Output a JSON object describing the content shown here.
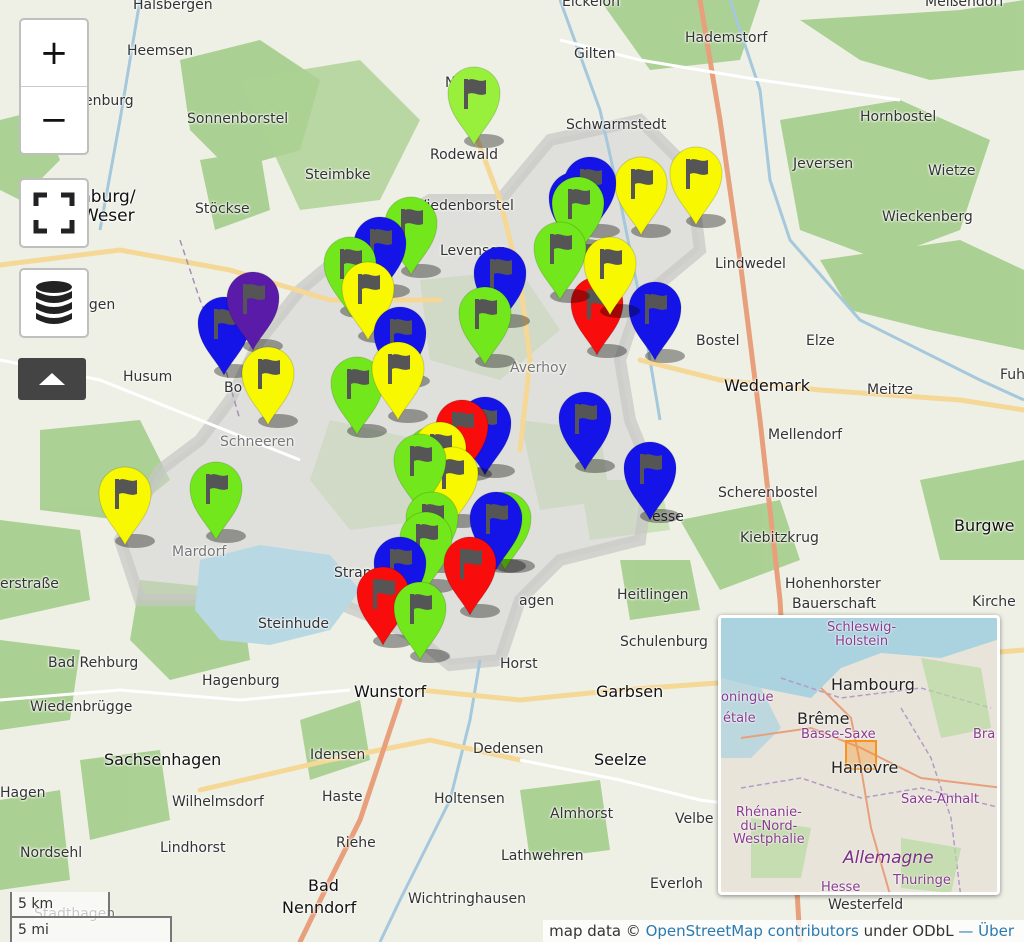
{
  "map": {
    "places": [
      {
        "name": "Halsbergen"
      },
      {
        "name": "Eickeloh"
      },
      {
        "name": "Meißendorf"
      },
      {
        "name": "Heemsen"
      },
      {
        "name": "Gilten"
      },
      {
        "name": "Hademstorf"
      },
      {
        "name": "enburg"
      },
      {
        "name": "Sonnenborstel"
      },
      {
        "name": "Nordel"
      },
      {
        "name": "Schwarmstedt"
      },
      {
        "name": "Hornbostel"
      },
      {
        "name": "Rodewald"
      },
      {
        "name": "Jeversen"
      },
      {
        "name": "Wietze"
      },
      {
        "name": "nburg/"
      },
      {
        "name": "Weser"
      },
      {
        "name": "Steimbke"
      },
      {
        "name": "Wiedenborstel"
      },
      {
        "name": "Stöckse"
      },
      {
        "name": "Wieckenberg"
      },
      {
        "name": "Levensen"
      },
      {
        "name": "Lindwedel"
      },
      {
        "name": "ngen"
      },
      {
        "name": "Bostel"
      },
      {
        "name": "Elze"
      },
      {
        "name": "Averhoy"
      },
      {
        "name": "Husum"
      },
      {
        "name": "Wedemark"
      },
      {
        "name": "Meitze"
      },
      {
        "name": "Fuh"
      },
      {
        "name": "Bo"
      },
      {
        "name": "Schneeren"
      },
      {
        "name": "Mellendorf"
      },
      {
        "name": "Scherenbostel"
      },
      {
        "name": "Burgwe"
      },
      {
        "name": "Mardorf"
      },
      {
        "name": "esse"
      },
      {
        "name": "Kiebitzkrug"
      },
      {
        "name": "erstraße"
      },
      {
        "name": "Strand"
      },
      {
        "name": "Hohenhorster"
      },
      {
        "name": "Bauerschaft"
      },
      {
        "name": "Kirche"
      },
      {
        "name": "Heitlingen"
      },
      {
        "name": "Steinhude"
      },
      {
        "name": "agen"
      },
      {
        "name": "Schulenburg"
      },
      {
        "name": "Bad Rehburg"
      },
      {
        "name": "Horst"
      },
      {
        "name": "Hagenburg"
      },
      {
        "name": "Wunstorf"
      },
      {
        "name": "Garbsen"
      },
      {
        "name": "Wiedenbrügge"
      },
      {
        "name": "Dedensen"
      },
      {
        "name": "Sachsenhagen"
      },
      {
        "name": "Idensen"
      },
      {
        "name": "Seelze"
      },
      {
        "name": "Hagen"
      },
      {
        "name": "Haste"
      },
      {
        "name": "Holtensen"
      },
      {
        "name": "Wilhelmsdorf"
      },
      {
        "name": "Almhorst"
      },
      {
        "name": "Velbe"
      },
      {
        "name": "Riehe"
      },
      {
        "name": "Nordsehl"
      },
      {
        "name": "Lindhorst"
      },
      {
        "name": "Lathwehren"
      },
      {
        "name": "Bad"
      },
      {
        "name": "Nenndorf"
      },
      {
        "name": "Everloh"
      },
      {
        "name": "Wichtringhausen"
      },
      {
        "name": "Westerfeld"
      },
      {
        "name": "Stadthagen"
      }
    ],
    "markers": [
      {
        "color": "#98f03c"
      },
      {
        "color": "#f8f800"
      },
      {
        "color": "#f8f800"
      },
      {
        "color": "#1414e8"
      },
      {
        "color": "#1414e8"
      },
      {
        "color": "#72e81c"
      },
      {
        "color": "#72e81c"
      },
      {
        "color": "#1414e8"
      },
      {
        "color": "#72e81c"
      },
      {
        "color": "#1414e8"
      },
      {
        "color": "#f8f800"
      },
      {
        "color": "#1414e8"
      },
      {
        "color": "#72e81c"
      },
      {
        "color": "#f80c0c"
      },
      {
        "color": "#1414e8"
      },
      {
        "color": "#5a1ca8"
      },
      {
        "color": "#1414e8"
      },
      {
        "color": "#f8f800"
      },
      {
        "color": "#72e81c"
      },
      {
        "color": "#f8f800"
      },
      {
        "color": "#1414e8"
      },
      {
        "color": "#f8f800"
      },
      {
        "color": "#72e81c"
      },
      {
        "color": "#72e81c"
      },
      {
        "color": "#1414e8"
      },
      {
        "color": "#f8f800"
      },
      {
        "color": "#72e81c"
      },
      {
        "color": "#f80c0c"
      },
      {
        "color": "#1414e8"
      },
      {
        "color": "#f8f800"
      },
      {
        "color": "#f8f800"
      },
      {
        "color": "#72e81c"
      },
      {
        "color": "#72e81c"
      },
      {
        "color": "#72e81c"
      },
      {
        "color": "#1414e8"
      },
      {
        "color": "#72e81c"
      },
      {
        "color": "#1414e8"
      },
      {
        "color": "#f80c0c"
      },
      {
        "color": "#f80c0c"
      },
      {
        "color": "#72e81c"
      }
    ]
  },
  "controls": {
    "zoom_in": "+",
    "zoom_out": "−"
  },
  "scale": {
    "km": "5 km",
    "mi": "5 mi"
  },
  "attribution": {
    "prefix": "map data © ",
    "osm_link": "OpenStreetMap contributors",
    "middle": " under ODbL ",
    "about_link": "— Über"
  },
  "minimap": {
    "labels": {
      "schleswig": "Schleswig-\nHolstein",
      "hamburg": "Hambourg",
      "bremen": "Brême",
      "basse_saxe": "Basse-Saxe",
      "hanovre": "Hanovre",
      "saxe_anhalt": "Saxe-Anhalt",
      "rhenanie": "Rhénanie-\ndu-Nord-\nWestphalie",
      "allemagne": "Allemagne",
      "hesse": "Hesse",
      "thuringe": "Thuringe",
      "groningue": "oningue",
      "etale": "étale",
      "bra": "Bra"
    }
  }
}
